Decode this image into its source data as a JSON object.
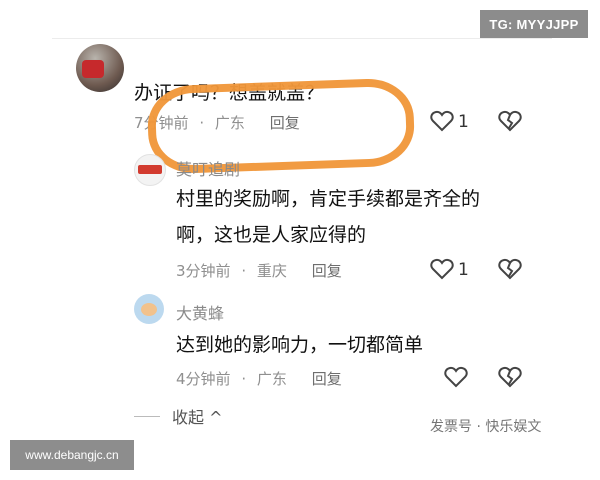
{
  "overlay": {
    "tg_badge": "TG: MYYJJPP",
    "site_badge": "www.debangjc.cn",
    "watermark": "发票号 · 快乐娱文"
  },
  "colors": {
    "highlight": "#f0973a",
    "meta": "#8f8f8f",
    "username": "#8a8a8a"
  },
  "comments": [
    {
      "username": "",
      "text": "办证了吗？想盖就盖？",
      "time": "7分钟前",
      "location": "广东",
      "reply_label": "回复",
      "like_count": "1"
    },
    {
      "username": "莫叮追剧",
      "text_line1": "村里的奖励啊，肯定手续都是齐全的",
      "text_line2": "啊，这也是人家应得的",
      "time": "3分钟前",
      "location": "重庆",
      "reply_label": "回复",
      "like_count": "1"
    },
    {
      "username": "大黄蜂",
      "text": "达到她的影响力，一切都简单",
      "time": "4分钟前",
      "location": "广东",
      "reply_label": "回复",
      "like_count": ""
    }
  ],
  "collapse_label": "收起"
}
